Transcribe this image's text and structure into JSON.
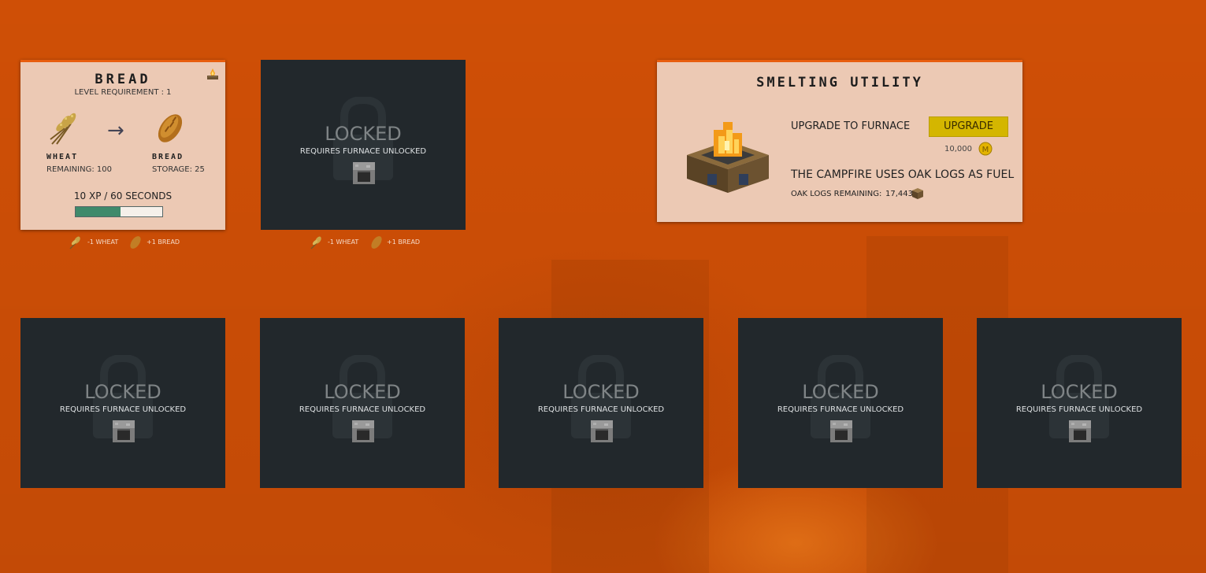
{
  "active_recipe": {
    "title": "BREAD",
    "level_requirement": "LEVEL REQUIREMENT : 1",
    "input_name": "WHEAT",
    "input_status": "REMAINING: 100",
    "output_name": "BREAD",
    "output_status": "STORAGE: 25",
    "xp_time": "10 XP / 60 SECONDS",
    "progress_fraction": 0.52,
    "input_delta": "-1 WHEAT",
    "output_delta": "+1 BREAD",
    "arrow": "→",
    "icons": [
      "campfire-icon",
      "wheat-icon",
      "arrow-right-icon",
      "bread-icon"
    ]
  },
  "locked_slots": [
    {
      "label": "LOCKED",
      "requirement": "REQUIRES FURNACE UNLOCKED",
      "input_delta": "-1 WHEAT",
      "output_delta": "+1 BREAD"
    },
    {
      "label": "LOCKED",
      "requirement": "REQUIRES FURNACE UNLOCKED"
    },
    {
      "label": "LOCKED",
      "requirement": "REQUIRES FURNACE UNLOCKED"
    },
    {
      "label": "LOCKED",
      "requirement": "REQUIRES FURNACE UNLOCKED"
    },
    {
      "label": "LOCKED",
      "requirement": "REQUIRES FURNACE UNLOCKED"
    },
    {
      "label": "LOCKED",
      "requirement": "REQUIRES FURNACE UNLOCKED"
    }
  ],
  "utility": {
    "title": "SMELTING UTILITY",
    "upgrade_label": "UPGRADE TO FURNACE",
    "upgrade_button": "UPGRADE",
    "upgrade_cost": "10,000",
    "fuel_text": "THE CAMPFIRE USES OAK LOGS AS FUEL",
    "logs_label": "OAK LOGS REMAINING:",
    "logs_value": "17,443",
    "coin_symbol": "M"
  },
  "colors": {
    "background": "#cf4f06",
    "card_active": "#ecc9b4",
    "card_locked": "#22282c",
    "accent_border": "#e85d0e",
    "progress_fill": "#3f8a6b",
    "upgrade_button": "#d4b600"
  }
}
